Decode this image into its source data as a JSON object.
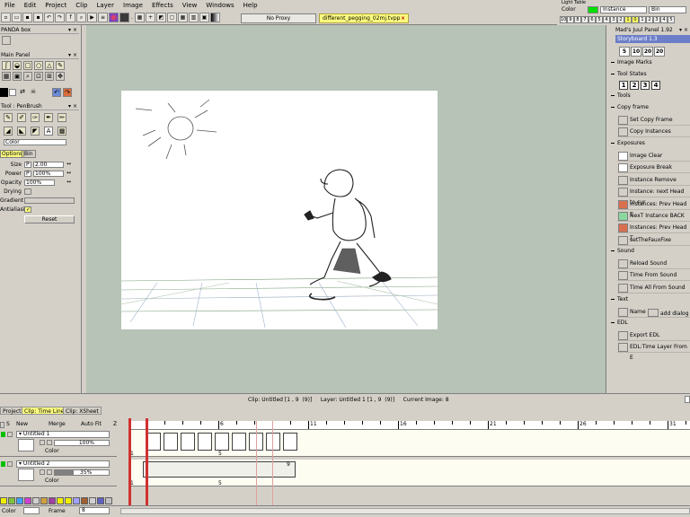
{
  "menu": [
    "File",
    "Edit",
    "Project",
    "Clip",
    "Layer",
    "Image",
    "Effects",
    "View",
    "Windows",
    "Help"
  ],
  "light_table_label": "Light Table",
  "toolbar": {
    "proxy_label": "No Proxy",
    "open_file": "different_pegging_02mj.tvpp",
    "close_symbol": "×"
  },
  "light_table": {
    "mode_label": "Color",
    "instance_label": "Instance",
    "bin_label": "Bin",
    "numbers_left": [
      "10",
      "9",
      "8",
      "7",
      "6",
      "5",
      "4",
      "3",
      "2",
      "1",
      "0"
    ],
    "numbers_right": [
      "1",
      "2",
      "3",
      "4",
      "5"
    ]
  },
  "left_panels": {
    "panda_title": "PANDA box",
    "main_title": "Main Panel",
    "tool_title": "Tool : PenBrush",
    "color_mode": "Color",
    "tab_options": "Options",
    "tab_bin": "Bin",
    "props": [
      {
        "label": "Size",
        "flag": "P",
        "value": "2.00"
      },
      {
        "label": "Power",
        "flag": "P",
        "value": "100%"
      },
      {
        "label": "Opacity",
        "flag": "",
        "value": "100%"
      },
      {
        "label": "Drying",
        "flag": "",
        "value": ""
      },
      {
        "label": "Gradient",
        "flag": "",
        "value": ""
      },
      {
        "label": "Antialiasing",
        "flag": "",
        "value": "✓"
      }
    ],
    "reset_label": "Reset"
  },
  "right_panel": {
    "title": "Mad's Juul Panel 1.92",
    "storyboard": "Storyboard 1.3",
    "storyboard_nums": [
      "5",
      "10",
      "20",
      "20"
    ],
    "image_marks": "Image Marks",
    "tool_states": "Tool States",
    "tool_state_nums": [
      "1",
      "2",
      "3",
      "4"
    ],
    "tools": "Tools",
    "copy_frame": "Copy frame",
    "buttons_copy": [
      "Set Copy Frame",
      "Copy Instances"
    ],
    "exposures": "Exposures",
    "buttons_exposures": [
      "Image Clear",
      "Exposure Break",
      "Instance Remove",
      "Instance: next Head to cur",
      "Instances: Prev Head T",
      "NexT Instance BACK",
      "Instances: Prev Head T",
      "setTheFauxFixe"
    ],
    "sound": "Sound",
    "buttons_sound": [
      "Reload Sound",
      "Time From Sound",
      "Time All From Sound"
    ],
    "text": "Text",
    "name_label": "Name",
    "add_dialog": "add dialog",
    "edl": "EDL",
    "buttons_edl": [
      "Export EDL",
      "EDL:Time Layer From E"
    ]
  },
  "status": {
    "clip": "Clip: Untitled [1 , 9  (9)]",
    "layer": "Layer: Untitled 1 [1 , 9  (9)]",
    "current_image": "Current Image: 8"
  },
  "timeline": {
    "tabs": [
      "Project",
      "Clip: Time Line",
      "Clip: XSheet"
    ],
    "header": {
      "new": "New",
      "merge": "Merge",
      "auto_fit": "Auto Fit"
    },
    "ruler_labels": [
      "6",
      "11",
      "16",
      "21",
      "26",
      "31"
    ],
    "layers": [
      {
        "name": "Untitled 1",
        "opacity": "100%",
        "mode": "Color",
        "frame_first": "1",
        "frame_mark": "5"
      },
      {
        "name": "Untitled 2",
        "opacity": "35%",
        "mode": "Color",
        "frame_first": "1",
        "frame_mark": "5",
        "frame_end": "9"
      }
    ],
    "bottom_color": "Color",
    "frame_label": "Frame",
    "frame_value": "8"
  }
}
